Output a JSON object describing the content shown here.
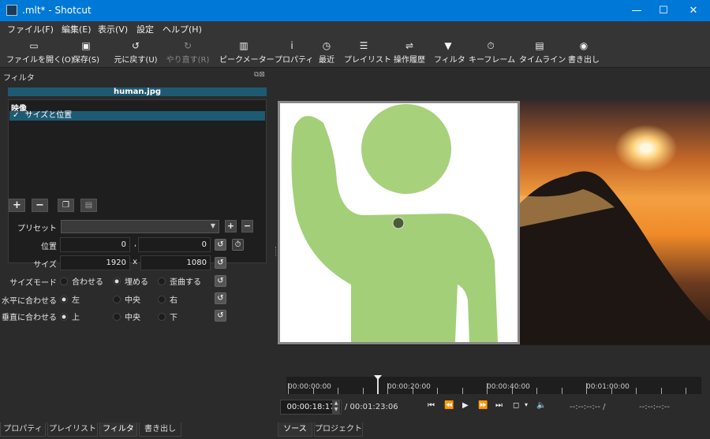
{
  "window": {
    "title": ".mlt* - Shotcut",
    "minimize": "—",
    "maximize": "☐",
    "close": "✕"
  },
  "menu": [
    "ファイル(F)",
    "編集(E)",
    "表示(V)",
    "設定",
    "ヘルプ(H)"
  ],
  "toolbar": [
    {
      "icon": "folder-open-icon",
      "glyph": "▭",
      "label": "ファイルを開く(O)"
    },
    {
      "icon": "save-icon",
      "glyph": "▣",
      "label": "保存(S)"
    },
    {
      "icon": "undo-icon",
      "glyph": "↺",
      "label": "元に戻す(U)"
    },
    {
      "icon": "redo-icon",
      "glyph": "↻",
      "label": "やり直す(R)",
      "disabled": true
    },
    {
      "icon": "peak-meter-icon",
      "glyph": "▥",
      "label": "ピークメーター"
    },
    {
      "icon": "info-icon",
      "glyph": "i",
      "label": "プロパティ"
    },
    {
      "icon": "clock-icon",
      "glyph": "◷",
      "label": "最近"
    },
    {
      "icon": "list-icon",
      "glyph": "☰",
      "label": "プレイリスト"
    },
    {
      "icon": "history-icon",
      "glyph": "⇌",
      "label": "操作履歴"
    },
    {
      "icon": "filter-icon",
      "glyph": "▼",
      "label": "フィルタ"
    },
    {
      "icon": "stopwatch-icon",
      "glyph": "⏱",
      "label": "キーフレーム"
    },
    {
      "icon": "timeline-icon",
      "glyph": "▤",
      "label": "タイムライン"
    },
    {
      "icon": "export-disc-icon",
      "glyph": "◉",
      "label": "書き出し"
    }
  ],
  "filters_panel": {
    "title": "フィルタ",
    "clip_name": "human.jpg",
    "group_header": "映像",
    "filters": [
      {
        "checked": "✓",
        "name": "サイズと位置"
      }
    ],
    "buttons": {
      "add": "+",
      "remove": "−",
      "copy": "❐",
      "paste": "▤"
    }
  },
  "properties": {
    "preset_label": "プリセット",
    "position_label": "位置",
    "position_x": "0",
    "position_sep": ",",
    "position_y": "0",
    "size_label": "サイズ",
    "size_w": "1920",
    "size_sep": "x",
    "size_h": "1080",
    "size_mode_label": "サイズモード",
    "size_mode_options": [
      "合わせる",
      "埋める",
      "歪曲する"
    ],
    "size_mode_selected": 1,
    "halign_label": "水平に合わせる",
    "halign_options": [
      "左",
      "中央",
      "右"
    ],
    "halign_selected": 0,
    "valign_label": "垂直に合わせる",
    "valign_options": [
      "上",
      "中央",
      "下"
    ],
    "valign_selected": 0,
    "reset_glyph": "↺",
    "keyframe_glyph": "⏱"
  },
  "left_tabs": [
    "プロパティ",
    "プレイリスト",
    "フィルタ",
    "書き出し"
  ],
  "left_tabs_active": 2,
  "timeline": {
    "labels": [
      "00:00:00:00",
      "00:00:20:00",
      "00:00:40:00",
      "00:01:00:00"
    ],
    "current": "00:00:18:17",
    "total": "/ 00:01:23:06",
    "in_point": "--:--:--:-- /",
    "out_point": "--:--:--:--"
  },
  "transport": [
    "⏮",
    "⏪",
    "▶",
    "⏩",
    "⏭",
    "◻",
    "▾",
    "🔈"
  ],
  "right_tabs": [
    "ソース",
    "プロジェクト"
  ],
  "right_tabs_active": 0
}
